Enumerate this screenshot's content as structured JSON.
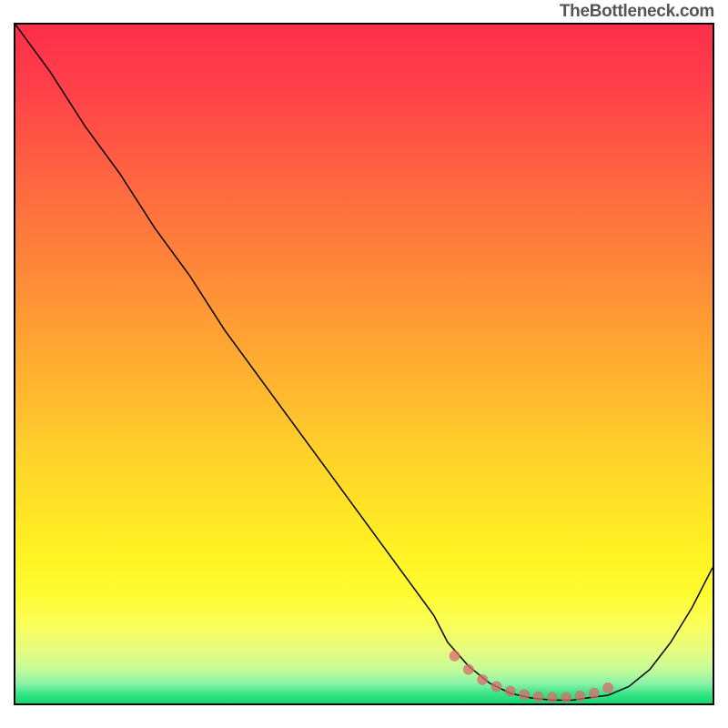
{
  "attribution": "TheBottleneck.com",
  "chart_data": {
    "type": "line",
    "title": "",
    "xlabel": "",
    "ylabel": "",
    "xlim": [
      0,
      100
    ],
    "ylim": [
      0,
      100
    ],
    "series": [
      {
        "name": "bottleneck-curve",
        "x": [
          0,
          5,
          10,
          15,
          20,
          25,
          30,
          35,
          40,
          45,
          50,
          55,
          60,
          62,
          65,
          68,
          71,
          74,
          77,
          80,
          82,
          85,
          88,
          91,
          94,
          97,
          100
        ],
        "y": [
          100,
          93,
          85,
          78,
          70,
          63,
          55,
          48,
          41,
          34,
          27,
          20,
          13,
          9,
          5.5,
          3,
          1.5,
          0.8,
          0.5,
          0.5,
          0.8,
          1.2,
          2.5,
          5,
          9,
          14,
          20
        ]
      }
    ],
    "optimal_zone": {
      "name": "optimal-markers",
      "x": [
        63,
        65,
        67,
        69,
        71,
        73,
        75,
        77,
        79,
        81,
        83,
        85
      ],
      "y": [
        7,
        5,
        3.5,
        2.5,
        1.8,
        1.3,
        1.0,
        0.9,
        0.9,
        1.1,
        1.5,
        2.3
      ]
    },
    "gradient_colors": {
      "top": "#ff2e4a",
      "middle": "#ffd32a",
      "bottom": "#0fd970"
    }
  }
}
